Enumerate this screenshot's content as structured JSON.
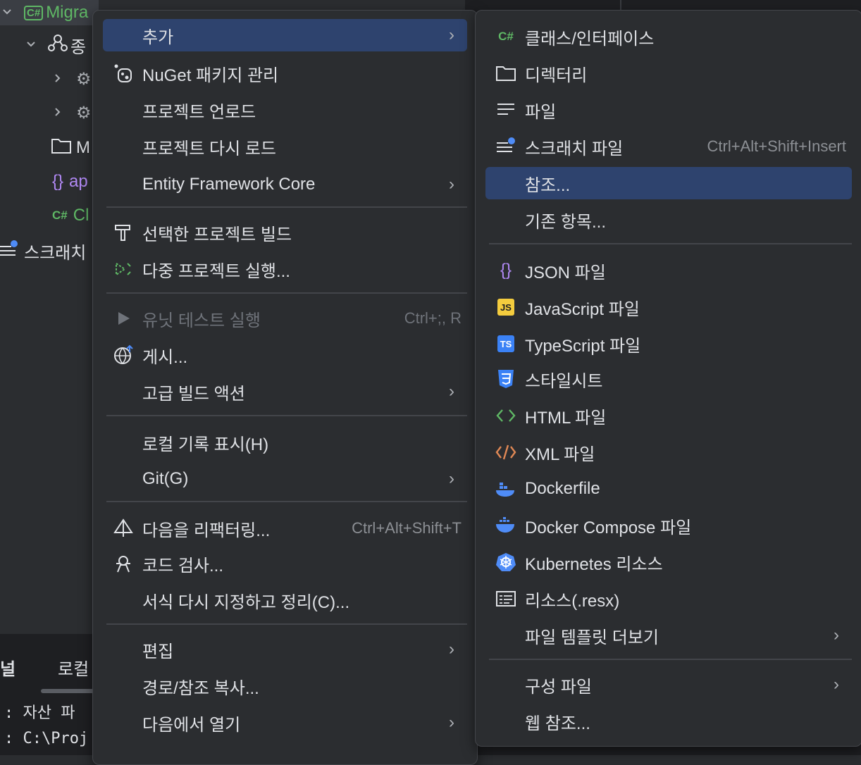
{
  "background": {
    "tree": {
      "project_name": "Migra",
      "rows": [
        "종",
        "M",
        "ap",
        "Cl"
      ],
      "scratch_label": "스크래치"
    },
    "bottom": {
      "tab_1": "널",
      "tab_2": "로컬",
      "line_1": ": 자산 파",
      "line_2": ": C:\\Proj"
    }
  },
  "menu1": {
    "items": [
      {
        "label": "추가",
        "submenu": true,
        "highlighted": true
      },
      {
        "label": "NuGet 패키지 관리",
        "icon": "nuget-icon"
      },
      {
        "label": "프로젝트 언로드"
      },
      {
        "label": "프로젝트 다시 로드"
      },
      {
        "label": "Entity Framework Core",
        "submenu": true
      },
      {
        "label": "선택한 프로젝트 빌드",
        "icon": "hammer-icon"
      },
      {
        "label": "다중 프로젝트 실행...",
        "icon": "multi-run-icon"
      },
      {
        "label": "유닛 테스트 실행",
        "icon": "run-icon",
        "shortcut": "Ctrl+;, R",
        "disabled": true
      },
      {
        "label": "게시...",
        "icon": "globe-publish-icon"
      },
      {
        "label": "고급 빌드 액션",
        "submenu": true
      },
      {
        "label": "로컬 기록 표시(H)"
      },
      {
        "label": "Git(G)",
        "submenu": true
      },
      {
        "label": "다음을 리팩터링...",
        "icon": "refactor-icon",
        "shortcut": "Ctrl+Alt+Shift+T"
      },
      {
        "label": "코드 검사...",
        "icon": "inspect-icon"
      },
      {
        "label": "서식 다시 지정하고 정리(C)..."
      },
      {
        "label": "편집",
        "submenu": true
      },
      {
        "label": "경로/참조 복사..."
      },
      {
        "label": "다음에서 열기",
        "submenu": true
      }
    ]
  },
  "menu2": {
    "items": [
      {
        "label": "클래스/인터페이스",
        "icon": "csharp-icon"
      },
      {
        "label": "디렉터리",
        "icon": "folder-icon"
      },
      {
        "label": "파일",
        "icon": "file-icon"
      },
      {
        "label": "스크래치 파일",
        "icon": "scratch-file-icon",
        "shortcut": "Ctrl+Alt+Shift+Insert"
      },
      {
        "label": "참조...",
        "highlighted": true
      },
      {
        "label": "기존 항목..."
      },
      {
        "label": "JSON 파일",
        "icon": "json-icon"
      },
      {
        "label": "JavaScript 파일",
        "icon": "javascript-icon",
        "badge": "JS"
      },
      {
        "label": "TypeScript 파일",
        "icon": "typescript-icon",
        "badge": "TS"
      },
      {
        "label": "스타일시트",
        "icon": "css-icon"
      },
      {
        "label": "HTML 파일",
        "icon": "html-icon"
      },
      {
        "label": "XML 파일",
        "icon": "xml-icon"
      },
      {
        "label": "Dockerfile",
        "icon": "docker-icon"
      },
      {
        "label": "Docker Compose 파일",
        "icon": "docker-compose-icon"
      },
      {
        "label": "Kubernetes 리소스",
        "icon": "kubernetes-icon"
      },
      {
        "label": "리소스(.resx)",
        "icon": "resx-icon"
      },
      {
        "label": "파일 템플릿 더보기",
        "submenu": true
      },
      {
        "label": "구성 파일",
        "submenu": true
      },
      {
        "label": "웹 참조..."
      }
    ]
  },
  "colors": {
    "highlight": "#2e436e",
    "menu_bg": "#2b2d30",
    "disabled_text": "#6f737a",
    "csharp": "#5fb865",
    "json": "#b189f5",
    "javascript": "#f4cc3e",
    "typescript": "#3b82f6",
    "css": "#3b82f6",
    "html": "#5fb865",
    "xml": "#e08855",
    "docker": "#4f8cf7"
  }
}
